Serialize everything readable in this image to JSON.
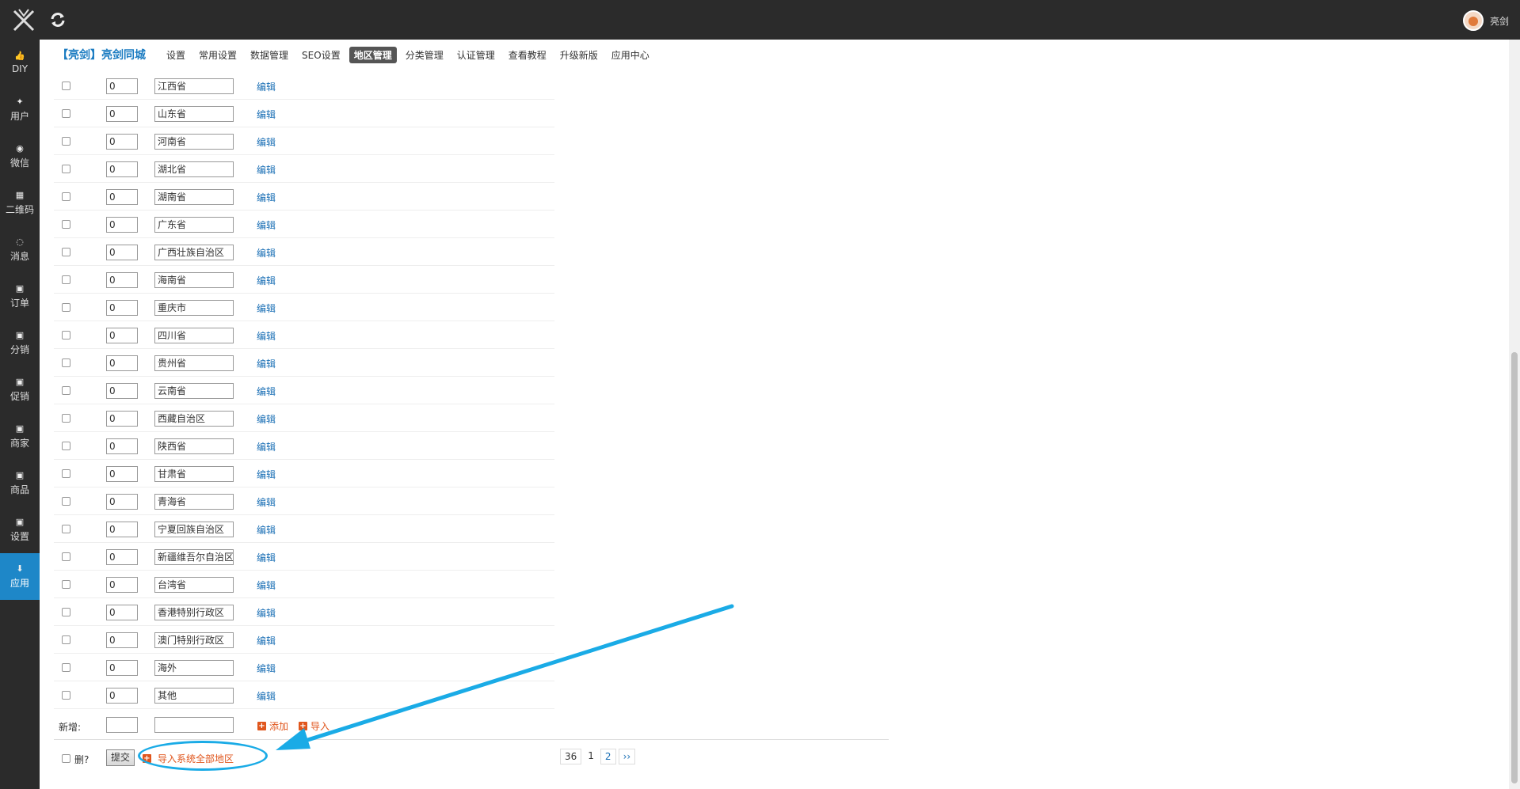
{
  "header": {
    "user_name": "亮剑"
  },
  "sidebar": {
    "items": [
      {
        "icon": "thumb-up-icon",
        "glyph": "👍",
        "label": "DIY"
      },
      {
        "icon": "user-icon",
        "glyph": "✦",
        "label": "用户"
      },
      {
        "icon": "wechat-icon",
        "glyph": "◉",
        "label": "微信"
      },
      {
        "icon": "qrcode-icon",
        "glyph": "▦",
        "label": "二维码"
      },
      {
        "icon": "message-icon",
        "glyph": "◌",
        "label": "消息"
      },
      {
        "icon": "doc-icon",
        "glyph": "▣",
        "label": "订单"
      },
      {
        "icon": "doc-icon",
        "glyph": "▣",
        "label": "分销"
      },
      {
        "icon": "doc-icon",
        "glyph": "▣",
        "label": "促销"
      },
      {
        "icon": "doc-icon",
        "glyph": "▣",
        "label": "商家"
      },
      {
        "icon": "doc-icon",
        "glyph": "▣",
        "label": "商品"
      },
      {
        "icon": "doc-icon",
        "glyph": "▣",
        "label": "设置"
      },
      {
        "icon": "download-icon",
        "glyph": "⬇",
        "label": "应用"
      }
    ]
  },
  "nav": {
    "brand": "【亮剑】亮剑同城",
    "items": [
      "设置",
      "常用设置",
      "数据管理",
      "SEO设置",
      "地区管理",
      "分类管理",
      "认证管理",
      "查看教程",
      "升级新版",
      "应用中心"
    ],
    "active": "地区管理"
  },
  "rows": [
    {
      "order": "0",
      "name": "江西省"
    },
    {
      "order": "0",
      "name": "山东省"
    },
    {
      "order": "0",
      "name": "河南省"
    },
    {
      "order": "0",
      "name": "湖北省"
    },
    {
      "order": "0",
      "name": "湖南省"
    },
    {
      "order": "0",
      "name": "广东省"
    },
    {
      "order": "0",
      "name": "广西壮族自治区"
    },
    {
      "order": "0",
      "name": "海南省"
    },
    {
      "order": "0",
      "name": "重庆市"
    },
    {
      "order": "0",
      "name": "四川省"
    },
    {
      "order": "0",
      "name": "贵州省"
    },
    {
      "order": "0",
      "name": "云南省"
    },
    {
      "order": "0",
      "name": "西藏自治区"
    },
    {
      "order": "0",
      "name": "陕西省"
    },
    {
      "order": "0",
      "name": "甘肃省"
    },
    {
      "order": "0",
      "name": "青海省"
    },
    {
      "order": "0",
      "name": "宁夏回族自治区"
    },
    {
      "order": "0",
      "name": "新疆维吾尔自治区"
    },
    {
      "order": "0",
      "name": "台湾省"
    },
    {
      "order": "0",
      "name": "香港特别行政区"
    },
    {
      "order": "0",
      "name": "澳门特别行政区"
    },
    {
      "order": "0",
      "name": "海外"
    },
    {
      "order": "0",
      "name": "其他"
    }
  ],
  "edit_label": "编辑",
  "new_row": {
    "label": "新增:",
    "add_label": "添加",
    "import_label": "导入"
  },
  "footer": {
    "delete_label": "删?",
    "submit_label": "提交",
    "import_all_label": "导入系统全部地区"
  },
  "pager": {
    "total": "36",
    "pages": [
      "1",
      "2"
    ],
    "next": "››"
  },
  "colors": {
    "accent": "#1aabe6",
    "link": "#1a6fb5",
    "action": "#e0561d",
    "sidebar": "#2b2b2b",
    "active": "#1e87c8"
  }
}
